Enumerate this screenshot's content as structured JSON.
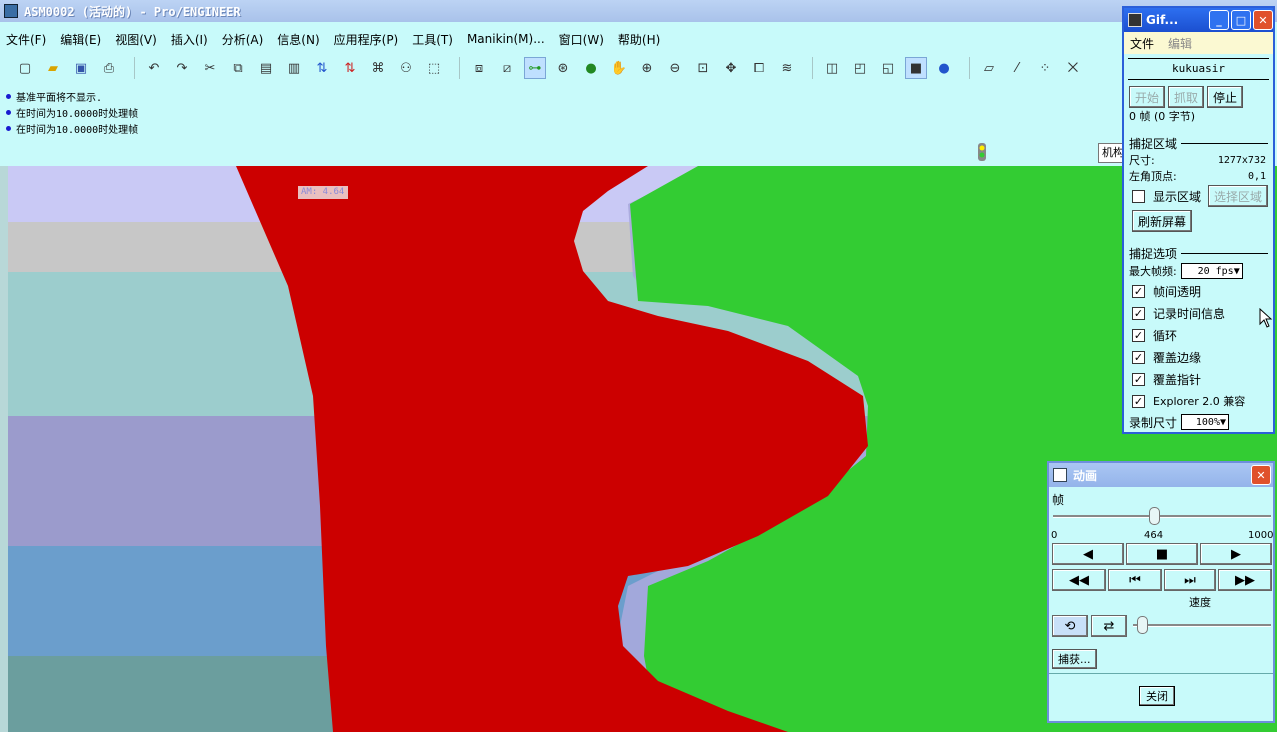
{
  "window": {
    "title": "ASM0002 (活动的) - Pro/ENGINEER"
  },
  "menu": [
    "文件(F)",
    "编辑(E)",
    "视图(V)",
    "插入(I)",
    "分析(A)",
    "信息(N)",
    "应用程序(P)",
    "工具(T)",
    "Manikin(M)...",
    "窗口(W)",
    "帮助(H)"
  ],
  "messages": [
    "基准平面将不显示.",
    "在时间为10.0000时处理帧",
    "在时间为10.0000时处理帧"
  ],
  "model_tree_button": "机构",
  "viewport_label": "AM: 4.64",
  "colors": {
    "red_part": "#cc0000",
    "green_part": "#33cc33",
    "accent_blue": "#2b5fd9"
  },
  "gif": {
    "title": "Gif...",
    "menu_file": "文件",
    "menu_edit": "编辑",
    "name": "kukuasir",
    "btn_start": "开始",
    "btn_grab": "抓取",
    "btn_stop": "停止",
    "frames": "0 帧 (0 字节)",
    "capture_area": "捕捉区域",
    "size_label": "尺寸:",
    "size_value": "1277x732",
    "corner_label": "左角顶点:",
    "corner_value": "0,1",
    "show_area": "显示区域",
    "select_area": "选择区域",
    "refresh": "刷新屏幕",
    "options": "捕捉选项",
    "max_fps_label": "最大帧频:",
    "max_fps_value": "20 fps",
    "opt_transparent": "帧间透明",
    "opt_time": "记录时间信息",
    "opt_loop": "循环",
    "opt_edge": "覆盖边缘",
    "opt_pointer": "覆盖指针",
    "opt_explorer": "Explorer 2.0 兼容",
    "rec_size_label": "录制尺寸",
    "rec_size_value": "100%"
  },
  "anim": {
    "title": "动画",
    "frame_label": "帧",
    "min": "0",
    "current": "464",
    "max": "1000",
    "frame_fraction": 0.464,
    "speed_label": "速度",
    "capture_btn": "捕获...",
    "close_btn": "关闭"
  }
}
